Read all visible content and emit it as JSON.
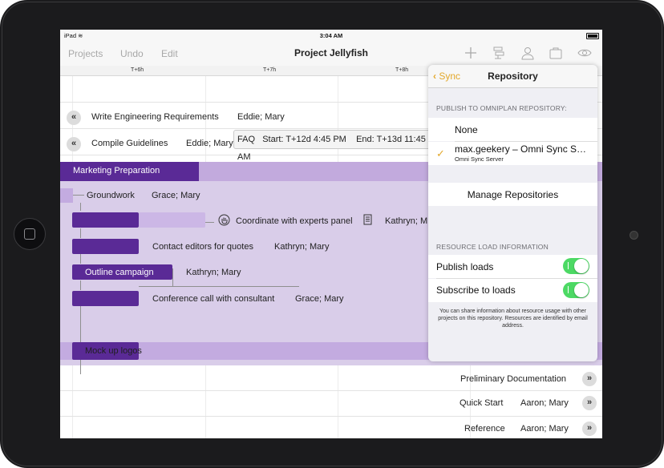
{
  "status_bar": {
    "device": "iPad",
    "time": "3:04 AM"
  },
  "toolbar": {
    "projects_label": "Projects",
    "undo_label": "Undo",
    "edit_label": "Edit",
    "title": "Project Jellyfish",
    "icons": [
      "plus-icon",
      "structure-icon",
      "person-icon",
      "briefcase-icon",
      "eye-icon"
    ]
  },
  "timeline": {
    "ticks": [
      "T+6h",
      "T+7h",
      "T+8h"
    ]
  },
  "faq": {
    "label": "FAQ",
    "start": "Start: T+12d 4:45 PM",
    "end": "End: T+13d 11:45 AM"
  },
  "tasks": [
    {
      "name": "Write Engineering Requirements",
      "resources": "Eddie; Mary"
    },
    {
      "name": "Compile Guidelines",
      "resources": "Eddie; Mary"
    },
    {
      "name": "Marketing Preparation",
      "resources": ""
    },
    {
      "name": "Groundwork",
      "resources": "Grace; Mary"
    },
    {
      "name": "Coordinate with experts panel",
      "resources": "Kathryn; M"
    },
    {
      "name": "Contact editors for quotes",
      "resources": "Kathryn; Mary"
    },
    {
      "name": "Outline campaign",
      "resources": "Kathryn; Mary"
    },
    {
      "name": "Conference call with consultant",
      "resources": "Grace; Mary"
    },
    {
      "name": "Mock up logos",
      "resources": ""
    },
    {
      "name": "Preliminary Documentation",
      "resources": ""
    },
    {
      "name": "Quick Start",
      "resources": "Aaron; Mary"
    },
    {
      "name": "Reference",
      "resources": "Aaron; Mary"
    }
  ],
  "popover": {
    "back_label": "Sync",
    "title": "Repository",
    "publish_header": "PUBLISH TO OMNIPLAN REPOSITORY:",
    "none_label": "None",
    "repo_name": "max.geekery – Omni Sync S…",
    "repo_sub": "Omni Sync Server",
    "manage_label": "Manage Repositories",
    "resource_header": "RESOURCE LOAD INFORMATION",
    "publish_loads": "Publish loads",
    "publish_loads_on": true,
    "subscribe_loads": "Subscribe to loads",
    "subscribe_loads_on": true,
    "footnote": "You can share information about resource usage with other projects on this repository. Resources are identified by email address.",
    "accent_color": "#e3a82b",
    "toggle_color": "#4cd964"
  },
  "colors": {
    "bar_dark": "#5a2a96",
    "bar_light": "#c3abe0",
    "region": "#d9cde9"
  }
}
